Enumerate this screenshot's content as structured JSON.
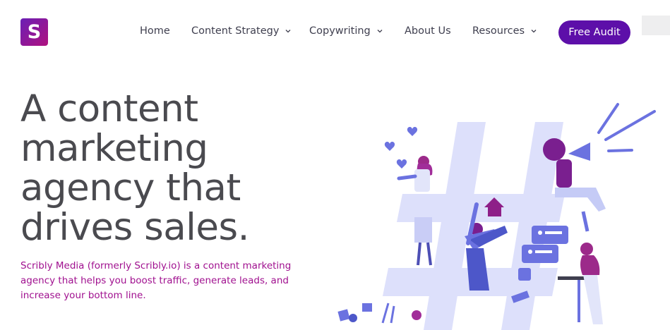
{
  "header": {
    "logo_letter": "S",
    "nav": [
      {
        "label": "Home"
      },
      {
        "label": "Content Strategy"
      },
      {
        "label": "Copywriting"
      },
      {
        "label": "About Us"
      },
      {
        "label": "Resources"
      }
    ],
    "cta_label": "Free Audit"
  },
  "hero": {
    "title_lines": [
      "A content",
      "marketing",
      "agency that",
      "drives sales."
    ],
    "subtitle_lines": [
      "Scribly Media (formerly Scribly.io) is a content marketing",
      "agency that helps you boost traffic, generate leads, and",
      "increase your bottom line."
    ]
  },
  "colors": {
    "brand_purple": "#5d0fa9",
    "magenta": "#a0108f",
    "heading_gray": "#4a4a4f",
    "illustration_blue": "#6b72e0",
    "hashtag_light": "#dde0fb"
  }
}
